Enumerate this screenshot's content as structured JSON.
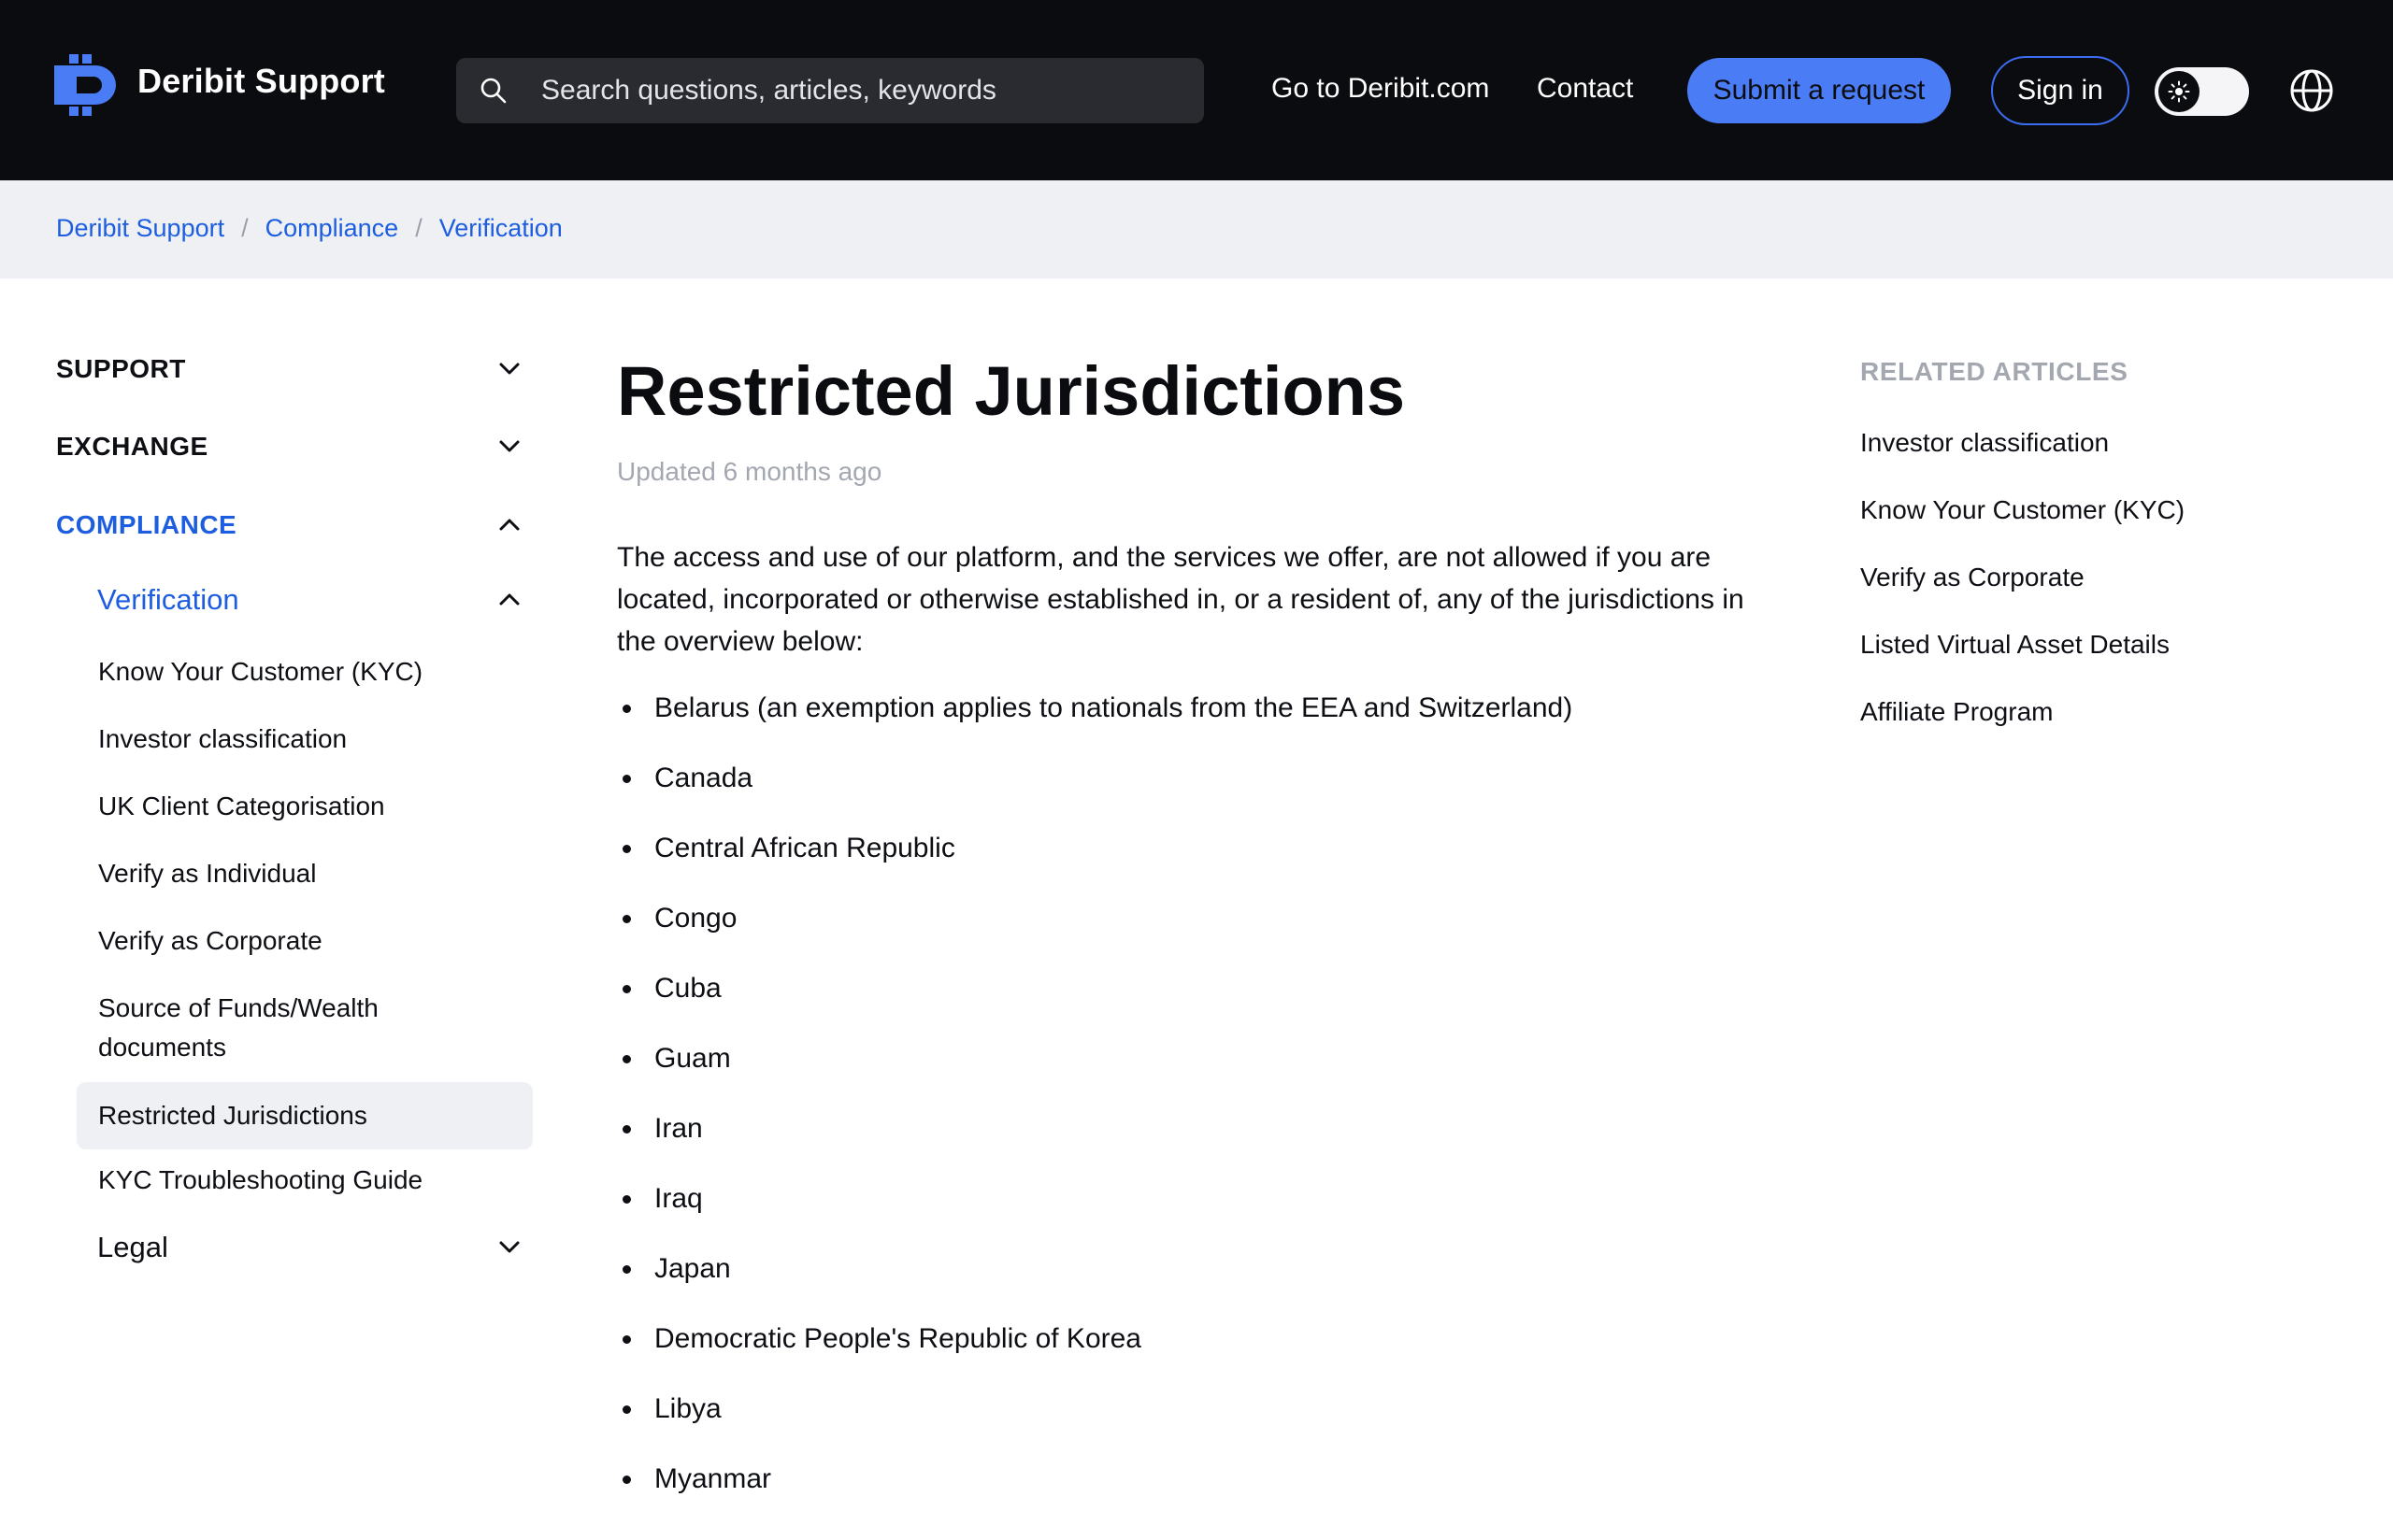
{
  "header": {
    "brand": "Deribit Support",
    "search_placeholder": "Search questions, articles, keywords",
    "nav_deribit": "Go to Deribit.com",
    "nav_contact": "Contact",
    "submit_label": "Submit a request",
    "signin_label": "Sign in",
    "accent": "#4a7cf5"
  },
  "breadcrumb": [
    "Deribit Support",
    "Compliance",
    "Verification"
  ],
  "sidebar": {
    "sections": [
      "SUPPORT",
      "EXCHANGE",
      "COMPLIANCE"
    ],
    "subsection": "Verification",
    "items": [
      "Know Your Customer (KYC)",
      "Investor classification",
      "UK Client Categorisation",
      "Verify as Individual",
      "Verify as Corporate",
      "Source of Funds/Wealth documents",
      "Restricted Jurisdictions",
      "KYC Troubleshooting Guide"
    ],
    "legal": "Legal"
  },
  "article": {
    "title": "Restricted Jurisdictions",
    "updated": "Updated 6 months ago",
    "intro": "The access and use of our platform, and the services we offer, are not allowed if you are located, incorporated or otherwise established in, or a resident of, any of the jurisdictions in the overview below:",
    "jurisdictions": [
      "Belarus (an exemption applies to nationals from the EEA and Switzerland)",
      "Canada",
      "Central African Republic",
      "Congo",
      "Cuba",
      "Guam",
      "Iran",
      "Iraq",
      "Japan",
      "Democratic People's Republic of Korea",
      "Libya",
      "Myanmar"
    ]
  },
  "related": {
    "heading": "RELATED ARTICLES",
    "items": [
      "Investor classification",
      "Know Your Customer (KYC)",
      "Verify as Corporate",
      "Listed Virtual Asset Details",
      "Affiliate Program"
    ]
  }
}
